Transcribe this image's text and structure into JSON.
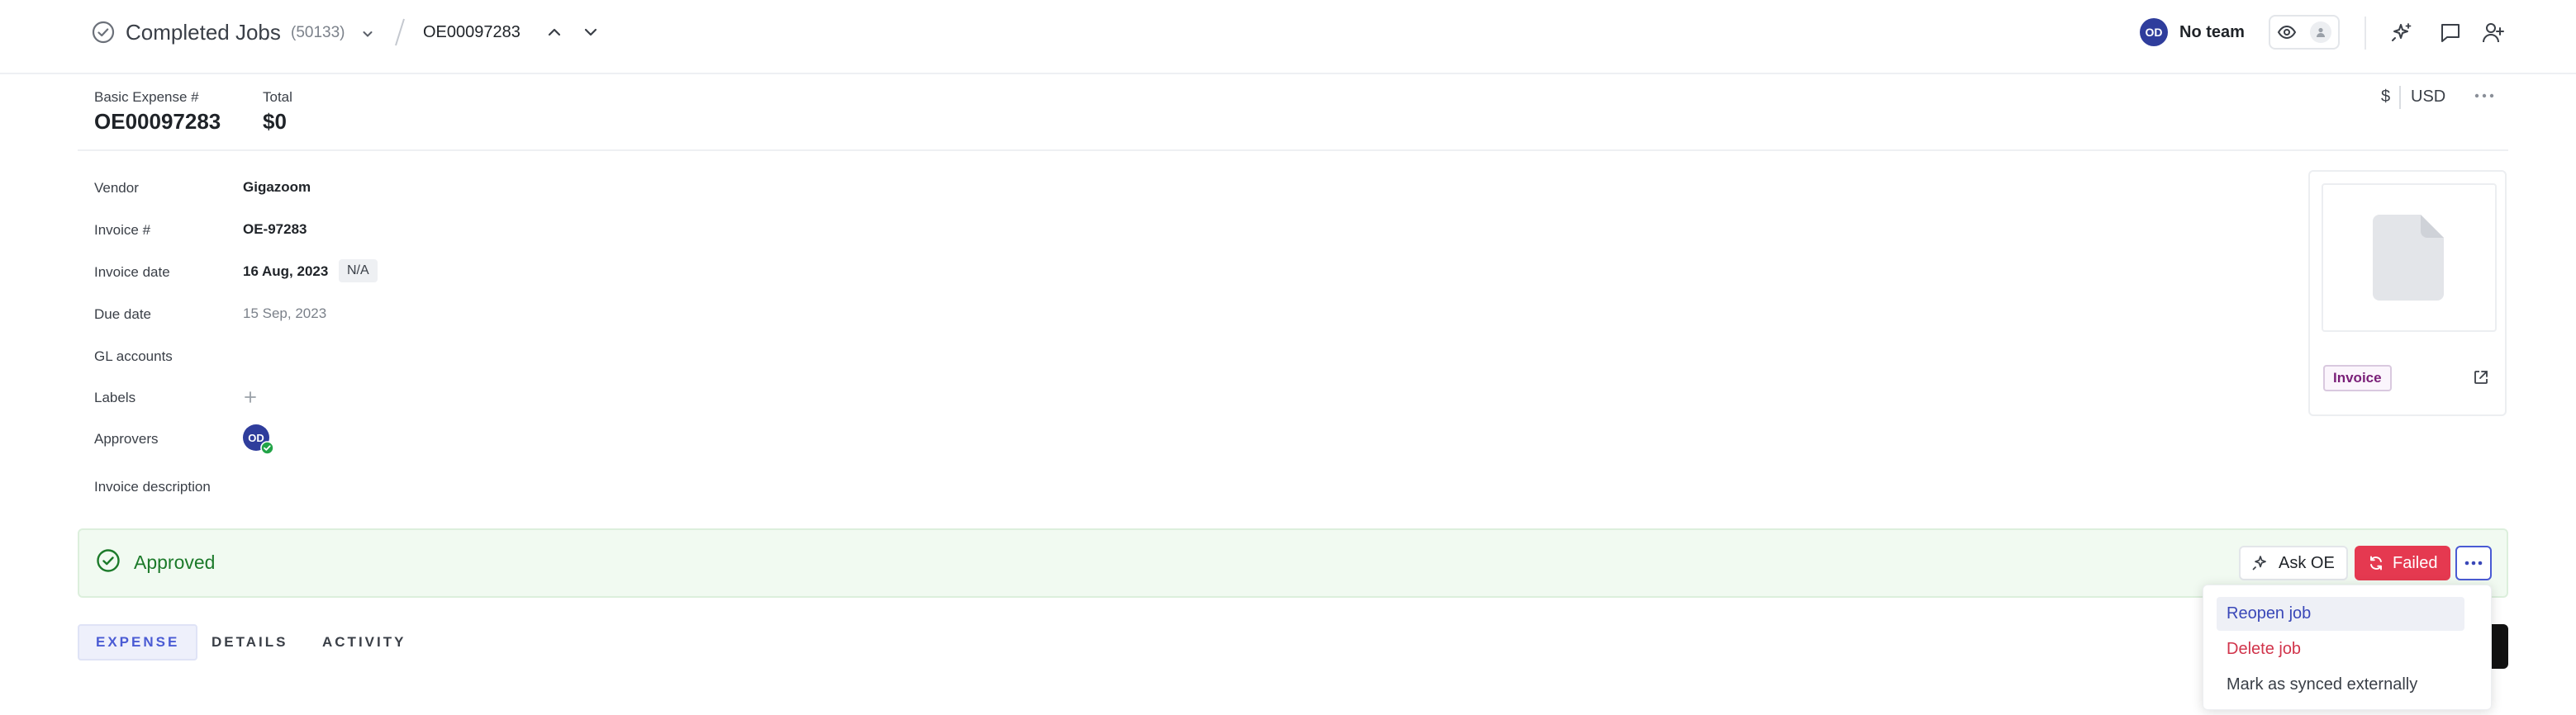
{
  "header": {
    "title": "Completed Jobs",
    "count": "(50133)",
    "job_id": "OE00097283",
    "avatar_initials": "OD",
    "team": "No team"
  },
  "expense": {
    "id_label": "Basic Expense #",
    "id_value": "OE00097283",
    "total_label": "Total",
    "total_value": "$0",
    "currency_symbol": "$",
    "currency_code": "USD"
  },
  "fields": {
    "vendor_label": "Vendor",
    "vendor_value": "Gigazoom",
    "invoice_num_label": "Invoice #",
    "invoice_num_value": "OE-97283",
    "invoice_date_label": "Invoice date",
    "invoice_date_value": "16 Aug, 2023",
    "invoice_date_tag": "N/A",
    "due_date_label": "Due date",
    "due_date_value": "15 Sep, 2023",
    "gl_label": "GL accounts",
    "labels_label": "Labels",
    "approvers_label": "Approvers",
    "approver_initials": "OD",
    "description_label": "Invoice description"
  },
  "document": {
    "tag": "Invoice"
  },
  "status": {
    "text": "Approved",
    "ask_label": "Ask OE",
    "failed_label": "Failed"
  },
  "tabs": [
    "EXPENSE",
    "DETAILS",
    "ACTIVITY"
  ],
  "menu": {
    "items": [
      "Reopen job",
      "Delete job",
      "Mark as synced externally"
    ]
  },
  "colors": {
    "accent": "#4a5bd4",
    "approved": "#1c7a2a",
    "failed": "#e53950",
    "danger": "#d1344b"
  }
}
